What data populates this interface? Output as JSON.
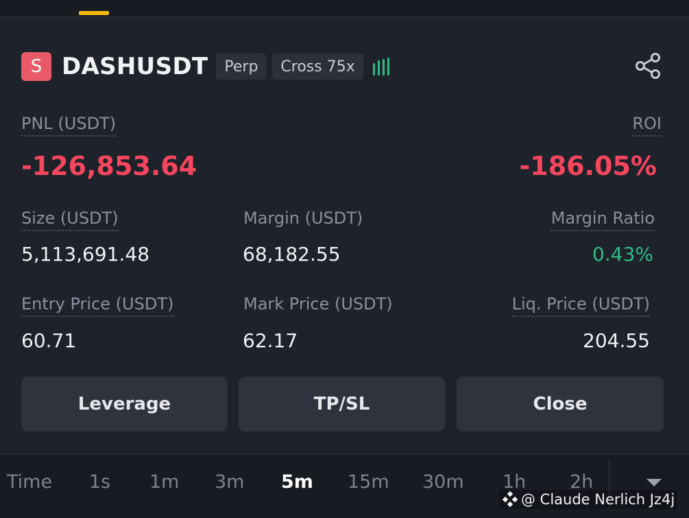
{
  "position": {
    "symbol": "DASHUSDT",
    "symbol_icon_letter": "S",
    "type_tag": "Perp",
    "margin_tag": "Cross 75x",
    "share_icon": "share-icon"
  },
  "pnl": {
    "label": "PNL (USDT)",
    "value": "-126,853.64"
  },
  "roi": {
    "label": "ROI",
    "value": "-186.05%"
  },
  "size": {
    "label": "Size (USDT)",
    "value": "5,113,691.48"
  },
  "margin": {
    "label": "Margin (USDT)",
    "value": "68,182.55"
  },
  "margin_ratio": {
    "label": "Margin Ratio",
    "value": "0.43%"
  },
  "entry_price": {
    "label": "Entry Price (USDT)",
    "value": "60.71"
  },
  "mark_price": {
    "label": "Mark Price (USDT)",
    "value": "62.17"
  },
  "liq_price": {
    "label": "Liq. Price (USDT)",
    "value": "204.55"
  },
  "buttons": {
    "leverage": "Leverage",
    "tpsl": "TP/SL",
    "close": "Close"
  },
  "timeframes": {
    "time_label": "Time",
    "items": [
      "1s",
      "1m",
      "3m",
      "5m",
      "15m",
      "30m",
      "1h",
      "2h"
    ],
    "selected": "5m"
  },
  "watermark": {
    "text": "@ Claude Nerlich Jz4j"
  },
  "colors": {
    "negative": "#f6465d",
    "positive": "#2ebd85",
    "accent": "#f0b90b",
    "background": "#1e222b"
  }
}
